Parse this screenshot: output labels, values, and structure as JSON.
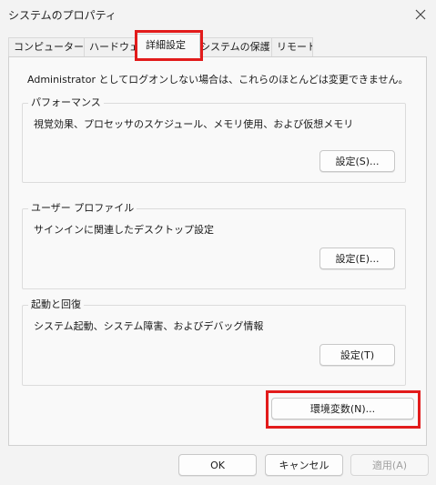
{
  "window": {
    "title": "システムのプロパティ",
    "close_icon": "close-icon"
  },
  "tabs": [
    {
      "label": "コンピューター名",
      "active": false
    },
    {
      "label": "ハードウェア",
      "active": false
    },
    {
      "label": "詳細設定",
      "active": true
    },
    {
      "label": "システムの保護",
      "active": false
    },
    {
      "label": "リモート",
      "active": false
    }
  ],
  "admin_note": "Administrator としてログオンしない場合は、これらのほとんどは変更できません。",
  "performance": {
    "title": "パフォーマンス",
    "description": "視覚効果、プロセッサのスケジュール、メモリ使用、および仮想メモリ",
    "button": "設定(S)..."
  },
  "user_profile": {
    "title": "ユーザー プロファイル",
    "description": "サインインに関連したデスクトップ設定",
    "button": "設定(E)..."
  },
  "startup_recovery": {
    "title": "起動と回復",
    "description": "システム起動、システム障害、およびデバッグ情報",
    "button": "設定(T)"
  },
  "env_button": "環境変数(N)...",
  "footer": {
    "ok": "OK",
    "cancel": "キャンセル",
    "apply": "適用(A)"
  },
  "colors": {
    "highlight": "#e21b1b",
    "window_bg": "#f3f3f3",
    "panel_bg": "#f9f9f9"
  }
}
